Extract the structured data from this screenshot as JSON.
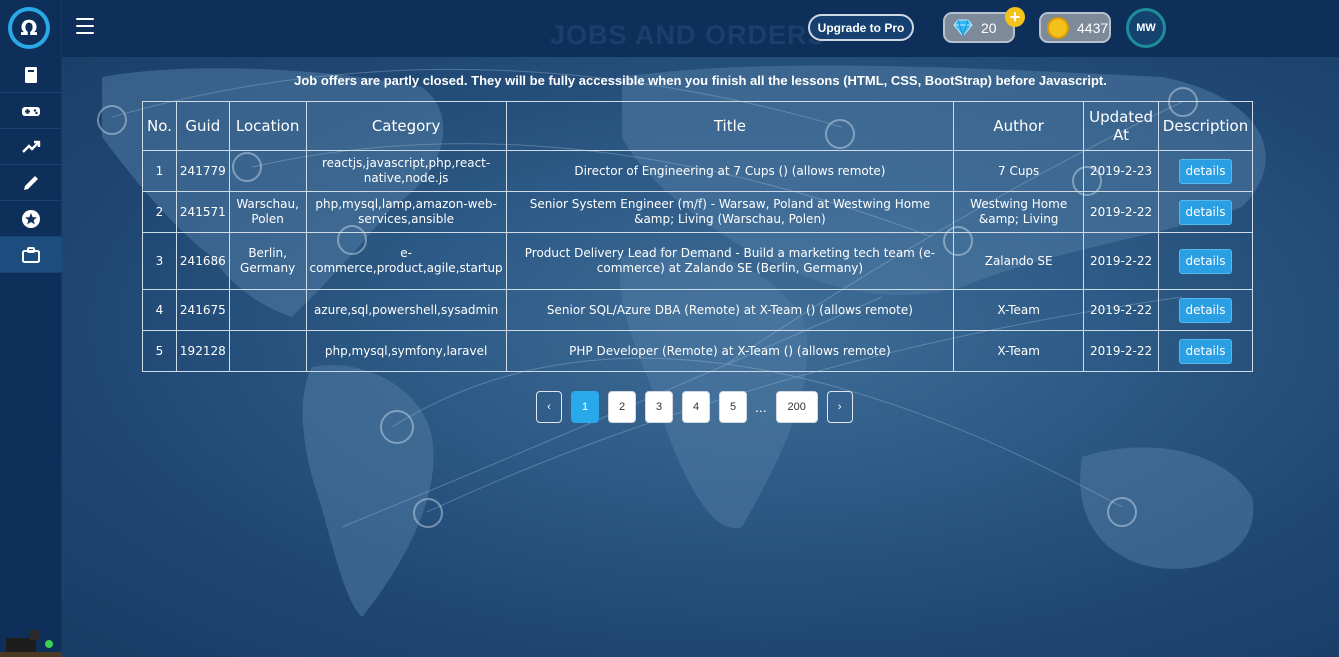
{
  "app": {
    "logo_glyph": "Ω",
    "page_title_ghost": "JOBS AND ORDERS"
  },
  "sidebar": {
    "items": [
      {
        "name": "book-icon"
      },
      {
        "name": "gamepad-icon"
      },
      {
        "name": "trending-up-icon"
      },
      {
        "name": "pencil-icon"
      },
      {
        "name": "star-badge-icon"
      },
      {
        "name": "briefcase-icon",
        "active": true
      }
    ]
  },
  "header": {
    "upgrade_label": "Upgrade to Pro",
    "gems": "20",
    "plus": "+",
    "coins": "4437",
    "avatar_initials": "MW"
  },
  "notice": "Job offers are partly closed. They will be fully accessible when you finish all the lessons (HTML, CSS, BootStrap) before Javascript.",
  "table": {
    "headers": {
      "no": "No.",
      "guid": "Guid",
      "location": "Location",
      "category": "Category",
      "title": "Title",
      "author": "Author",
      "updated": "Updated At",
      "description": "Description"
    },
    "rows": [
      {
        "no": "1",
        "guid": "241779",
        "location": "",
        "category": "reactjs,javascript,php,react-native,node.js",
        "title": "Director of Engineering at 7 Cups () (allows remote)",
        "author": "7 Cups",
        "updated": "2019-2-23",
        "action": "details"
      },
      {
        "no": "2",
        "guid": "241571",
        "location": "Warschau, Polen",
        "category": "php,mysql,lamp,amazon-web-services,ansible",
        "title": "Senior System Engineer (m/f) - Warsaw, Poland at Westwing Home &amp; Living (Warschau, Polen)",
        "author": "Westwing Home &amp; Living",
        "updated": "2019-2-22",
        "action": "details"
      },
      {
        "no": "3",
        "guid": "241686",
        "location": "Berlin, Germany",
        "category": "e-commerce,product,agile,startup",
        "title": "Product Delivery Lead for Demand - Build a marketing tech team (e-commerce) at Zalando SE (Berlin, Germany)",
        "author": "Zalando SE",
        "updated": "2019-2-22",
        "action": "details"
      },
      {
        "no": "4",
        "guid": "241675",
        "location": "",
        "category": "azure,sql,powershell,sysadmin",
        "title": "Senior SQL/Azure DBA (Remote) at X-Team () (allows remote)",
        "author": "X-Team",
        "updated": "2019-2-22",
        "action": "details"
      },
      {
        "no": "5",
        "guid": "192128",
        "location": "",
        "category": "php,mysql,symfony,laravel",
        "title": "PHP Developer (Remote) at X-Team () (allows remote)",
        "author": "X-Team",
        "updated": "2019-2-22",
        "action": "details"
      }
    ]
  },
  "pagination": {
    "prev": "‹",
    "next": "›",
    "ellipsis": "...",
    "pages": [
      "1",
      "2",
      "3",
      "4",
      "5"
    ],
    "last": "200",
    "current": "1"
  }
}
